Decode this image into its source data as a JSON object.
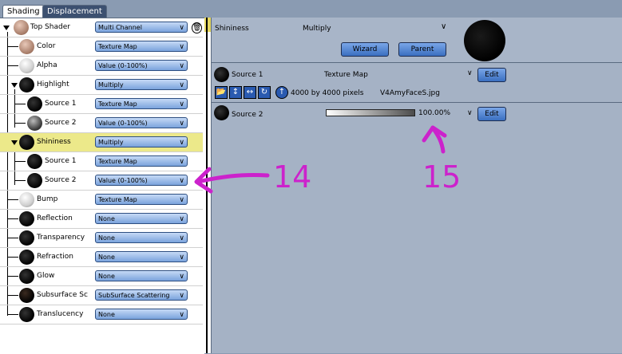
{
  "tabs": [
    "Shading",
    "Displacement"
  ],
  "tree": {
    "rows": [
      {
        "label": "Top Shader",
        "value": "Multi Channel"
      },
      {
        "label": "Color",
        "value": "Texture Map"
      },
      {
        "label": "Alpha",
        "value": "Value (0-100%)"
      },
      {
        "label": "Highlight",
        "value": "Multiply"
      },
      {
        "label": "Source 1",
        "value": "Texture Map"
      },
      {
        "label": "Source 2",
        "value": "Value (0-100%)"
      },
      {
        "label": "Shininess",
        "value": "Multiply"
      },
      {
        "label": "Source 1",
        "value": "Texture Map"
      },
      {
        "label": "Source 2",
        "value": "Value (0-100%)"
      },
      {
        "label": "Bump",
        "value": "Texture Map"
      },
      {
        "label": "Reflection",
        "value": "None"
      },
      {
        "label": "Transparency",
        "value": "None"
      },
      {
        "label": "Refraction",
        "value": "None"
      },
      {
        "label": "Glow",
        "value": "None"
      },
      {
        "label": "Subsurface Sc",
        "value": "SubSurface Scattering"
      },
      {
        "label": "Translucency",
        "value": "None"
      }
    ]
  },
  "panel": {
    "title": "Shininess",
    "mode": "Multiply",
    "wizard": "Wizard",
    "parent": "Parent",
    "source1": {
      "label": "Source 1",
      "type": "Texture Map",
      "edit": "Edit",
      "size": "4000 by 4000 pixels",
      "file": "V4AmyFaceS.jpg"
    },
    "source2": {
      "label": "Source 2",
      "value": "100.00%",
      "edit": "Edit"
    }
  },
  "annotations": {
    "a14": "14",
    "a15": "15"
  },
  "colors": {
    "accent_annotation": "#cc22cc",
    "selected_row": "#ece98a",
    "button": "#4a7fd0"
  }
}
